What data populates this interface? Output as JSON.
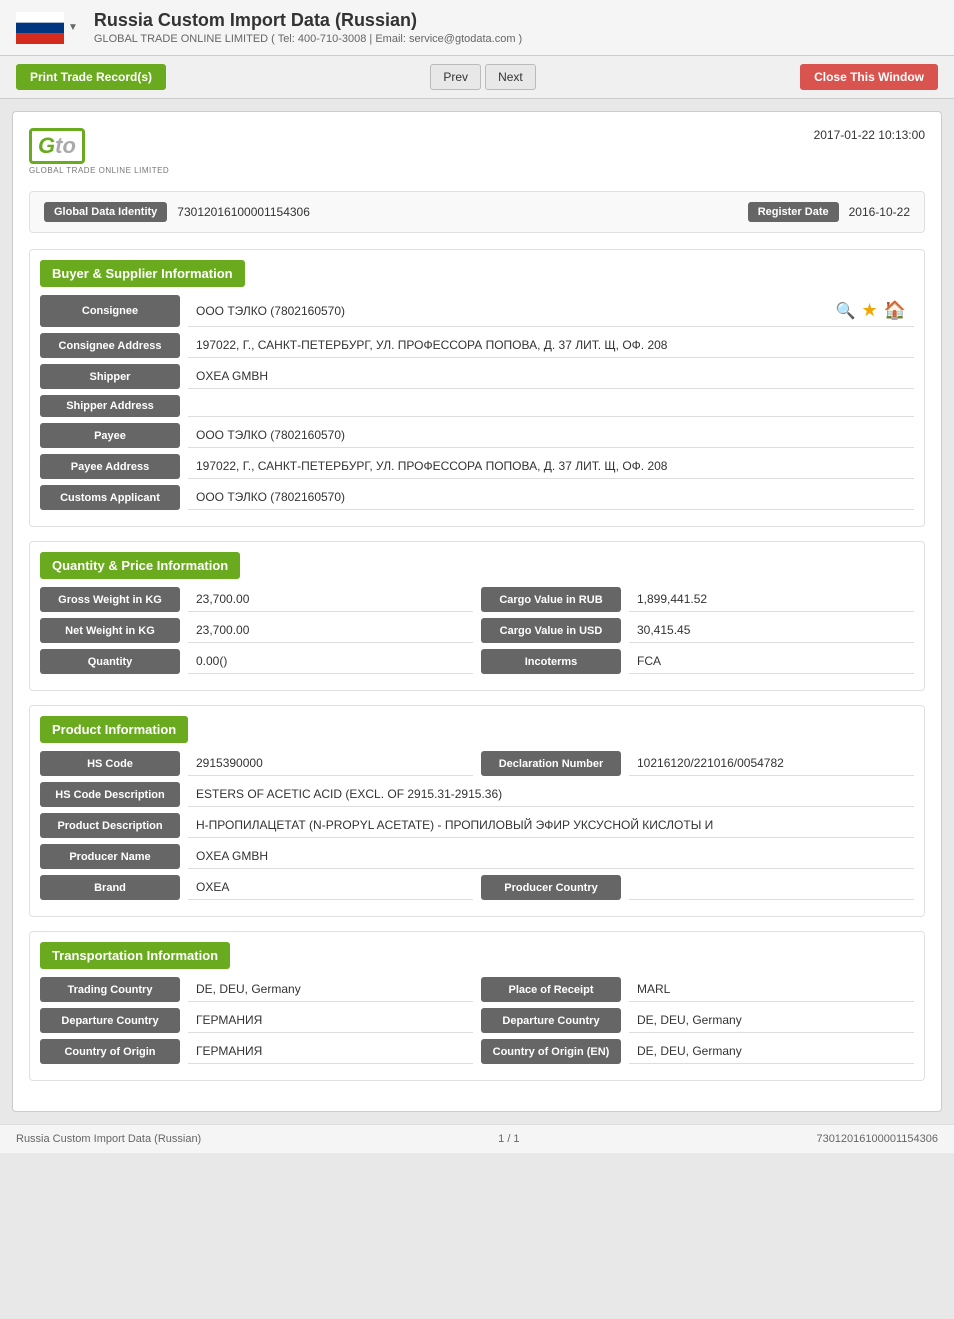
{
  "header": {
    "title": "Russia Custom Import Data (Russian)",
    "subtitle": "GLOBAL TRADE ONLINE LIMITED ( Tel: 400-710-3008 | Email: service@gtodata.com )",
    "dropdown_icon": "▼"
  },
  "toolbar": {
    "print_label": "Print Trade Record(s)",
    "prev_label": "Prev",
    "next_label": "Next",
    "close_label": "Close This Window"
  },
  "record": {
    "date": "2017-01-22 10:13:00",
    "logo_company": "GLOBAL TRADE ONLINE LIMITED",
    "global_data_identity_label": "Global Data Identity",
    "global_data_identity_value": "73012016100001154306",
    "register_date_label": "Register Date",
    "register_date_value": "2016-10-22"
  },
  "buyer_supplier": {
    "section_title": "Buyer & Supplier Information",
    "consignee_label": "Consignee",
    "consignee_value": "ООО ТЭЛКО (7802160570)",
    "consignee_address_label": "Consignee Address",
    "consignee_address_value": "197022, Г., САНКТ-ПЕТЕРБУРГ, УЛ. ПРОФЕССОРА ПОПОВА, Д. 37 ЛИТ. Щ, ОФ. 208",
    "shipper_label": "Shipper",
    "shipper_value": "OXEA GMBH",
    "shipper_address_label": "Shipper Address",
    "shipper_address_value": "",
    "payee_label": "Payee",
    "payee_value": "ООО ТЭЛКО (7802160570)",
    "payee_address_label": "Payee Address",
    "payee_address_value": "197022, Г., САНКТ-ПЕТЕРБУРГ, УЛ. ПРОФЕССОРА ПОПОВА, Д. 37 ЛИТ. Щ, ОФ. 208",
    "customs_applicant_label": "Customs Applicant",
    "customs_applicant_value": "ООО ТЭЛКО (7802160570)"
  },
  "quantity_price": {
    "section_title": "Quantity & Price Information",
    "gross_weight_label": "Gross Weight in KG",
    "gross_weight_value": "23,700.00",
    "cargo_value_rub_label": "Cargo Value in RUB",
    "cargo_value_rub_value": "1,899,441.52",
    "net_weight_label": "Net Weight in KG",
    "net_weight_value": "23,700.00",
    "cargo_value_usd_label": "Cargo Value in USD",
    "cargo_value_usd_value": "30,415.45",
    "quantity_label": "Quantity",
    "quantity_value": "0.00()",
    "incoterms_label": "Incoterms",
    "incoterms_value": "FCA"
  },
  "product": {
    "section_title": "Product Information",
    "hs_code_label": "HS Code",
    "hs_code_value": "2915390000",
    "declaration_number_label": "Declaration Number",
    "declaration_number_value": "10216120/221016/0054782",
    "hs_code_desc_label": "HS Code Description",
    "hs_code_desc_value": "ESTERS OF ACETIC ACID (EXCL. OF 2915.31-2915.36)",
    "product_desc_label": "Product Description",
    "product_desc_value": "Н-ПРОПИЛАЦЕТАТ (N-PROPYL ACETATE) - ПРОПИЛОВЫЙ ЭФИР УКСУСНОЙ КИСЛОТЫ И",
    "producer_name_label": "Producer Name",
    "producer_name_value": "OXEA GMBH",
    "brand_label": "Brand",
    "brand_value": "OXEA",
    "producer_country_label": "Producer Country",
    "producer_country_value": ""
  },
  "transportation": {
    "section_title": "Transportation Information",
    "trading_country_label": "Trading Country",
    "trading_country_value": "DE, DEU, Germany",
    "place_of_receipt_label": "Place of Receipt",
    "place_of_receipt_value": "MARL",
    "departure_country_label": "Departure Country",
    "departure_country_value": "ГЕРМАНИЯ",
    "departure_country_en_label": "Departure Country",
    "departure_country_en_value": "DE, DEU, Germany",
    "country_of_origin_label": "Country of Origin",
    "country_of_origin_value": "ГЕРМАНИЯ",
    "country_of_origin_en_label": "Country of Origin (EN)",
    "country_of_origin_en_value": "DE, DEU, Germany"
  },
  "footer": {
    "left": "Russia Custom Import Data (Russian)",
    "center": "1 / 1",
    "right": "73012016100001154306"
  }
}
